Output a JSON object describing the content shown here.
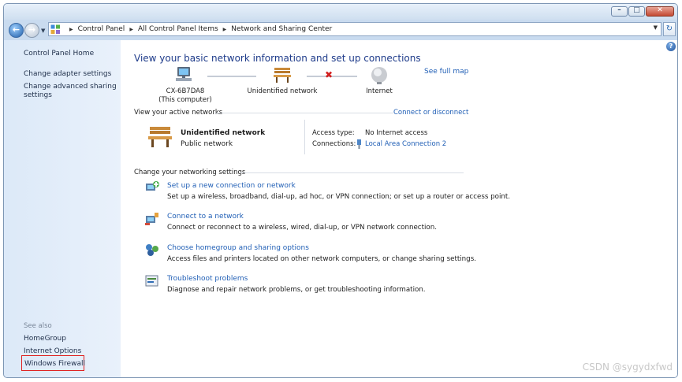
{
  "window": {
    "controls": {
      "minimize": "–",
      "maximize": "□",
      "close": "✕"
    }
  },
  "address_bar": {
    "crumbs": [
      "Control Panel",
      "All Control Panel Items",
      "Network and Sharing Center"
    ],
    "icon": "control-panel-icon"
  },
  "sidebar": {
    "home": "Control Panel Home",
    "links": [
      "Change adapter settings",
      "Change advanced sharing settings"
    ],
    "see_also_label": "See also",
    "see_also": [
      "HomeGroup",
      "Internet Options",
      "Windows Firewall"
    ]
  },
  "main": {
    "heading": "View your basic network information and set up connections",
    "see_full_map": "See full map",
    "map": {
      "computer_name": "CX-6B7DA8",
      "computer_sub": "(This computer)",
      "network": "Unidentified network",
      "internet": "Internet"
    },
    "active_networks": {
      "title": "View your active networks",
      "action": "Connect or disconnect",
      "name": "Unidentified network",
      "type": "Public network",
      "access_type_label": "Access type:",
      "access_type_value": "No Internet access",
      "connections_label": "Connections:",
      "connections_value": "Local Area Connection 2"
    },
    "settings": {
      "title": "Change your networking settings",
      "tasks": [
        {
          "title": "Set up a new connection or network",
          "desc": "Set up a wireless, broadband, dial-up, ad hoc, or VPN connection; or set up a router or access point."
        },
        {
          "title": "Connect to a network",
          "desc": "Connect or reconnect to a wireless, wired, dial-up, or VPN network connection."
        },
        {
          "title": "Choose homegroup and sharing options",
          "desc": "Access files and printers located on other network computers, or change sharing settings."
        },
        {
          "title": "Troubleshoot problems",
          "desc": "Diagnose and repair network problems, or get troubleshooting information."
        }
      ]
    }
  },
  "watermark": "CSDN @sygydxfwd",
  "colors": {
    "link": "#2260b6",
    "heading": "#1e3b8a",
    "highlight_box": "#e02020",
    "sidebar": "#dce9f8"
  }
}
